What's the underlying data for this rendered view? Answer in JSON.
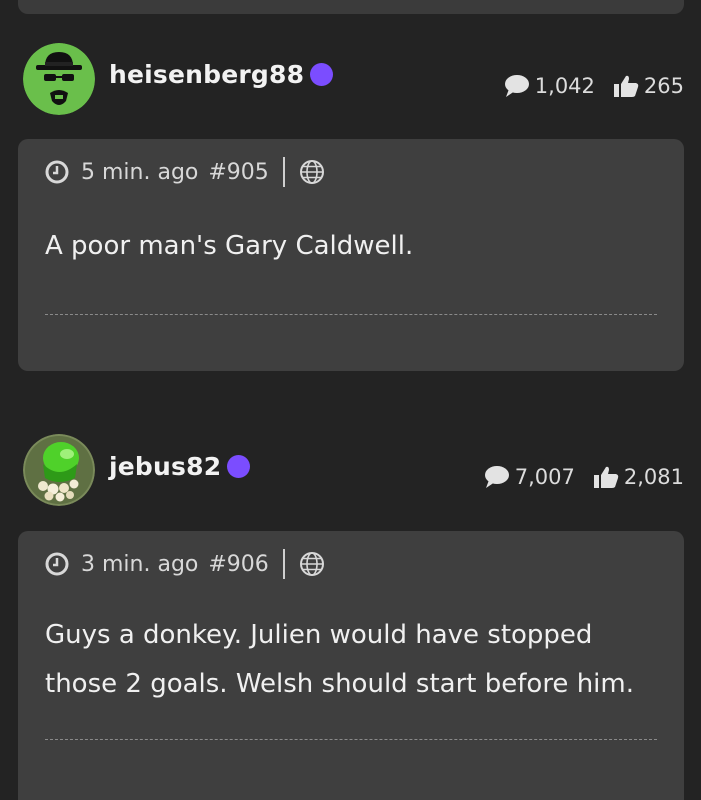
{
  "posts": [
    {
      "username": "heisenberg88",
      "comments": "1,042",
      "likes": "265",
      "time": "5 min. ago",
      "post_number": "#905",
      "text": "A poor man's Gary Caldwell."
    },
    {
      "username": "jebus82",
      "comments": "7,007",
      "likes": "2,081",
      "time": "3 min. ago",
      "post_number": "#906",
      "text": "Guys a donkey. Julien would have stopped those 2 goals. Welsh should start before him."
    }
  ],
  "colors": {
    "background": "#232323",
    "card": "#3f3f3f",
    "online_dot": "#7b4dff",
    "avatar_green": "#6abf4b"
  },
  "icons": {
    "comments": "speech-bubble-icon",
    "likes": "thumbs-up-icon",
    "time": "clock-icon",
    "visibility": "globe-icon"
  }
}
